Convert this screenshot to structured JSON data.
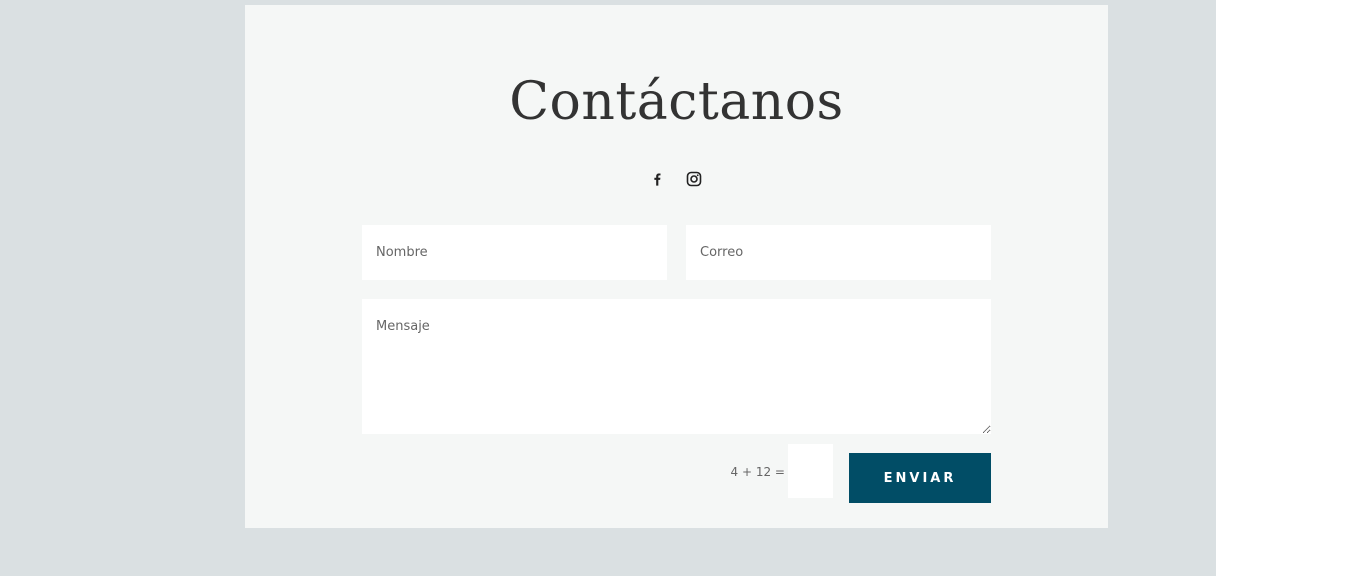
{
  "contact": {
    "title": "Contáctanos",
    "social": {
      "facebook_icon": "facebook-icon",
      "instagram_icon": "instagram-icon"
    },
    "form": {
      "name_placeholder": "Nombre",
      "email_placeholder": "Correo",
      "message_placeholder": "Mensaje",
      "captcha_question": "4 + 12 =",
      "captcha_value": "",
      "submit_label": "ENVIAR"
    }
  },
  "colors": {
    "page_background": "#dae0e2",
    "card_background": "#f5f7f6",
    "title_text": "#333333",
    "button_background": "#014d66",
    "button_text": "#ffffff"
  }
}
